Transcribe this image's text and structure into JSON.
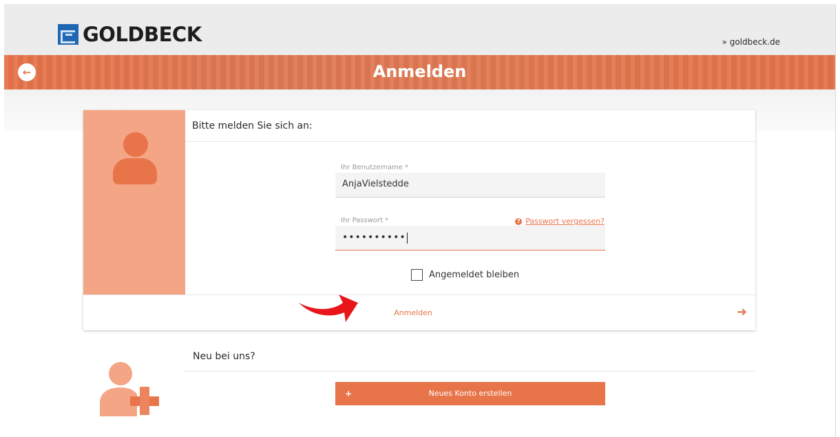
{
  "header": {
    "brand": "GOLDBECK",
    "external_link": "» goldbeck.de"
  },
  "titlebar": {
    "title": "Anmelden",
    "back_icon": "arrow-left-circle-icon"
  },
  "login": {
    "heading": "Bitte melden Sie sich an:",
    "username_label": "Ihr Benutzername *",
    "username_value": "AnjaVielstedde",
    "password_label": "Ihr Passwort *",
    "password_value": "••••••••••",
    "forgot_label": "Passwort vergessen?",
    "remember_label": "Angemeldet bleiben",
    "remember_checked": false,
    "submit_label": "Anmelden",
    "submit_icon": "arrow-right-icon"
  },
  "register": {
    "heading": "Neu bei uns?",
    "button_label": "Neues Konto erstellen",
    "button_icon": "add-user-icon"
  },
  "colors": {
    "accent": "#e8744a",
    "accent_light": "#f4a585",
    "annotation_arrow": "#e8161b",
    "brand_blue": "#1f66b3"
  }
}
